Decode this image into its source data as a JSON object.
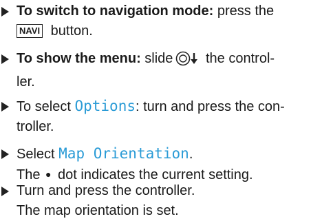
{
  "steps": [
    {
      "bold": "To switch to navigation mode:",
      "text": " press the",
      "button": "NAVI",
      "text2": " button."
    },
    {
      "bold": "To show the menu:",
      "text": " slide",
      "icon": "controller-slide-down-icon",
      "text2": " the control-",
      "text3": "ler."
    },
    {
      "text": "To select ",
      "option": "Options",
      "text2": ": turn and press the con-",
      "text3": "troller."
    },
    {
      "text": "Select ",
      "option": "Map Orientation",
      "text2": ".",
      "line2_pre": "The",
      "symbol": "●",
      "line2_post": " dot indicates the current setting."
    },
    {
      "text": "Turn and press the controller.",
      "line2": "The map orientation is set."
    }
  ]
}
